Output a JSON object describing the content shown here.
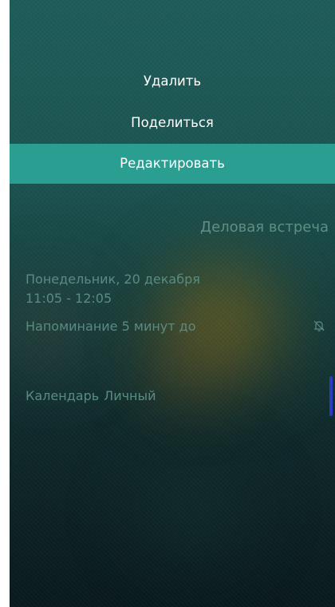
{
  "menu": {
    "items": [
      {
        "label": "Удалить"
      },
      {
        "label": "Поделиться"
      },
      {
        "label": "Редактировать"
      }
    ],
    "selected_index": 2
  },
  "event": {
    "title": "Деловая встреча",
    "date": "Понедельник, 20 декабря",
    "time": "11:05 - 12:05",
    "reminder": "Напоминание 5 минут до",
    "reminder_icon": "bell-off-icon",
    "calendar_label": "Календарь",
    "calendar_name": "Личный"
  },
  "colors": {
    "selected_bg": "#2b9e92",
    "calendar_accent": "#2a3cc6",
    "muted_text": "#5a8b83"
  }
}
